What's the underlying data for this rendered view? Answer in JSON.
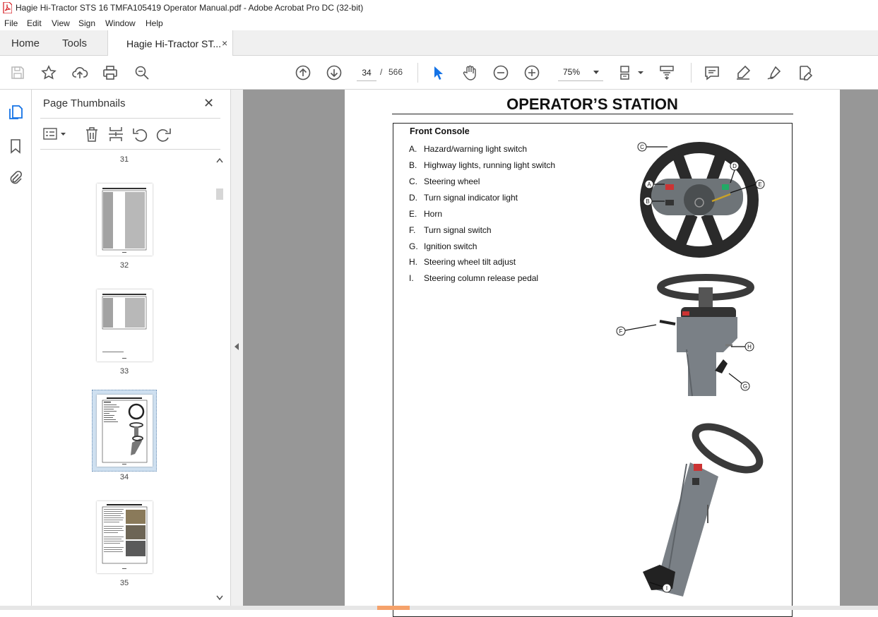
{
  "window": {
    "title": "Hagie Hi-Tractor STS 16 TMFA105419 Operator Manual.pdf - Adobe Acrobat Pro DC (32-bit)"
  },
  "menu": [
    "File",
    "Edit",
    "View",
    "Sign",
    "Window",
    "Help"
  ],
  "tabs": {
    "home": "Home",
    "tools": "Tools",
    "document": "Hagie Hi-Tractor ST...",
    "close": "×"
  },
  "toolbar": {
    "page_current": "34",
    "page_sep": "/",
    "page_total": "566",
    "zoom": "75%"
  },
  "panel": {
    "title": "Page Thumbnails",
    "close": "✕",
    "thumbnails": [
      {
        "label": "31"
      },
      {
        "label": "32"
      },
      {
        "label": "33"
      },
      {
        "label": "34",
        "selected": true
      },
      {
        "label": "35"
      }
    ]
  },
  "document": {
    "title": "OPERATOR’S STATION",
    "section": "Front Console",
    "items": [
      {
        "key": "A.",
        "text": "Hazard/warning light switch"
      },
      {
        "key": "B.",
        "text": "Highway lights, running light switch"
      },
      {
        "key": "C.",
        "text": "Steering wheel"
      },
      {
        "key": "D.",
        "text": "Turn signal indicator light"
      },
      {
        "key": "E.",
        "text": "Horn"
      },
      {
        "key": "F.",
        "text": "Turn signal switch"
      },
      {
        "key": "G.",
        "text": "Ignition switch"
      },
      {
        "key": "H.",
        "text": "Steering wheel tilt adjust"
      },
      {
        "key": "I.",
        "text": "Steering column release pedal"
      }
    ],
    "callouts_top": [
      "C",
      "D",
      "A",
      "E",
      "B"
    ],
    "callouts_mid": [
      "F",
      "H",
      "G"
    ],
    "callouts_bottom": [
      "I"
    ]
  },
  "colors": {
    "accent": "#1473e6",
    "pdf_red": "#d4161b",
    "doc_bg": "#979797"
  }
}
